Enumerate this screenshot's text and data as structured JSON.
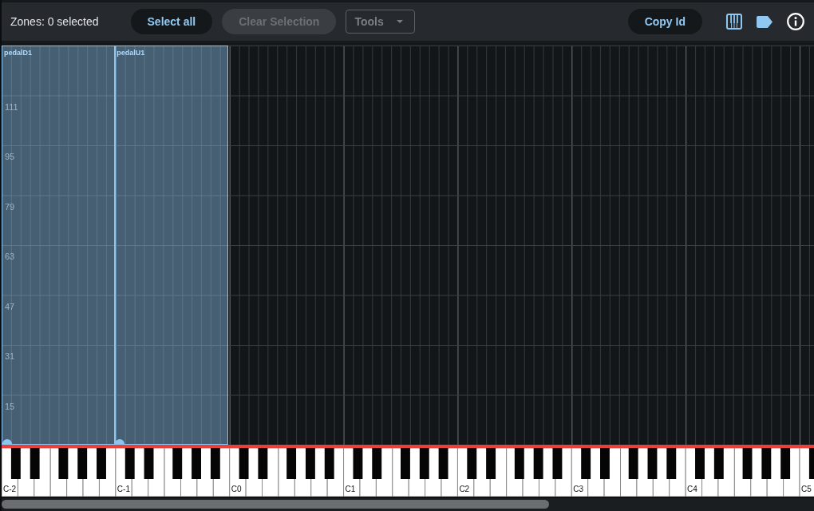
{
  "toolbar": {
    "status": "Zones: 0 selected",
    "buttons": [
      {
        "label": "Select all",
        "disabled": false
      },
      {
        "label": "Clear Selection",
        "disabled": true
      }
    ],
    "tools_menu": {
      "label": "Tools",
      "disabled": true
    },
    "copy_button": {
      "label": "Copy Id",
      "disabled": false
    },
    "view_buttons": [
      {
        "kind": "piano",
        "on": true
      },
      {
        "kind": "tag",
        "on": true
      },
      {
        "kind": "info",
        "on": false
      }
    ]
  },
  "zone_map": {
    "velocity_labels": [
      "111",
      "95",
      "79",
      "63",
      "47",
      "31",
      "15"
    ],
    "zones": [
      {
        "label": "pedalD1",
        "selected": false
      },
      {
        "label": "pedalU1",
        "selected": false
      }
    ]
  },
  "keyboard": {
    "octave_labels": [
      "C-2",
      "C-1",
      "C0",
      "C1",
      "C2",
      "C3",
      "C4",
      "C5"
    ]
  }
}
